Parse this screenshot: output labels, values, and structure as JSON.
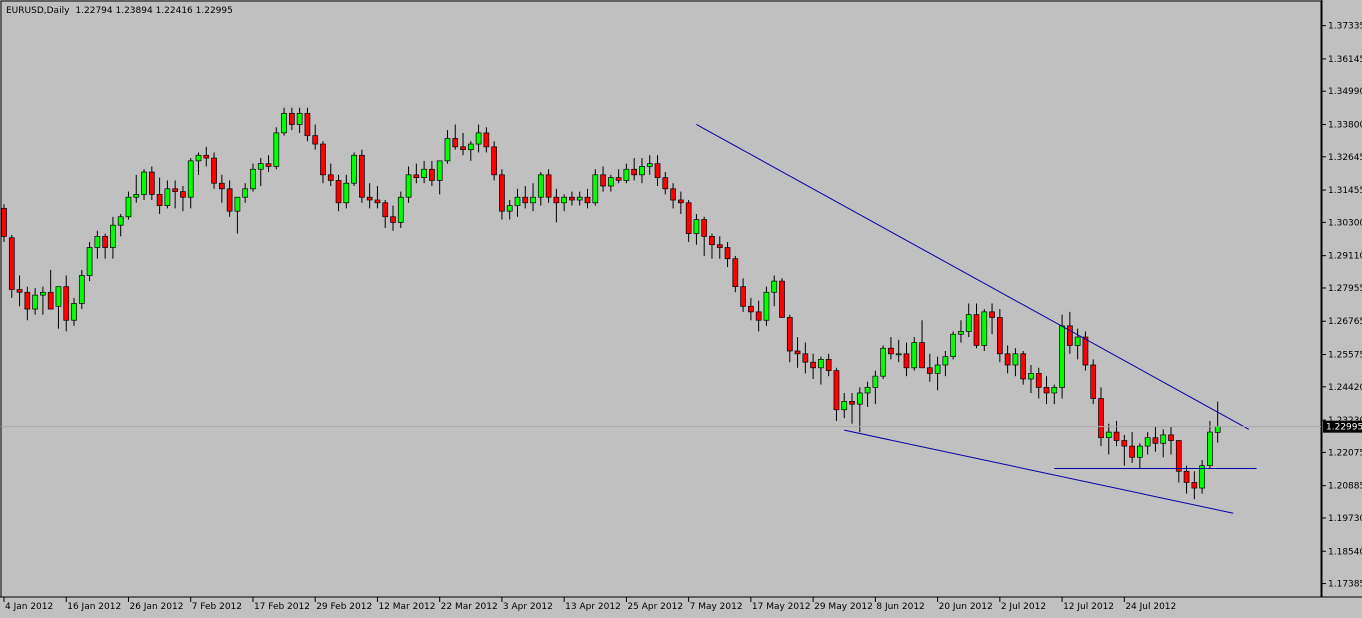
{
  "header": {
    "symbol": "EURUSD,Daily",
    "ohlc": "1.22794 1.23894 1.22416 1.22995"
  },
  "colors": {
    "background": "#c0c0c0",
    "bull_candle": "#00ff00",
    "bear_candle": "#ff0000",
    "wick": "#000000",
    "trendline": "#0000a0",
    "price_marker_bg": "#000000",
    "price_marker_text": "#ffffff"
  },
  "chart_data": {
    "type": "candlestick",
    "symbol": "EURUSD",
    "timeframe": "Daily",
    "ylim": [
      1.1694,
      1.3818
    ],
    "grid": false,
    "y_ticks": [
      "1.37335",
      "1.36145",
      "1.34990",
      "1.33800",
      "1.32645",
      "1.31455",
      "1.30300",
      "1.29110",
      "1.27955",
      "1.26765",
      "1.25575",
      "1.24420",
      "1.23230",
      "1.22075",
      "1.20885",
      "1.19730",
      "1.18540",
      "1.17385"
    ],
    "x_labels": [
      {
        "i": 0,
        "label": "4 Jan 2012"
      },
      {
        "i": 8,
        "label": "16 Jan 2012"
      },
      {
        "i": 16,
        "label": "26 Jan 2012"
      },
      {
        "i": 24,
        "label": "7 Feb 2012"
      },
      {
        "i": 32,
        "label": "17 Feb 2012"
      },
      {
        "i": 40,
        "label": "29 Feb 2012"
      },
      {
        "i": 48,
        "label": "12 Mar 2012"
      },
      {
        "i": 56,
        "label": "22 Mar 2012"
      },
      {
        "i": 64,
        "label": "3 Apr 2012"
      },
      {
        "i": 72,
        "label": "13 Apr 2012"
      },
      {
        "i": 80,
        "label": "25 Apr 2012"
      },
      {
        "i": 88,
        "label": "7 May 2012"
      },
      {
        "i": 96,
        "label": "17 May 2012"
      },
      {
        "i": 104,
        "label": "29 May 2012"
      },
      {
        "i": 112,
        "label": "8 Jun 2012"
      },
      {
        "i": 120,
        "label": "20 Jun 2012"
      },
      {
        "i": 128,
        "label": "2 Jul 2012"
      },
      {
        "i": 136,
        "label": "12 Jul 2012"
      },
      {
        "i": 144,
        "label": "24 Jul 2012"
      }
    ],
    "last_price": "1.22995",
    "candles": [
      [
        1.308,
        1.3095,
        1.296,
        1.298
      ],
      [
        1.2975,
        1.2985,
        1.276,
        1.279
      ],
      [
        1.279,
        1.284,
        1.273,
        1.278
      ],
      [
        1.278,
        1.28,
        1.268,
        1.272
      ],
      [
        1.272,
        1.2795,
        1.27,
        1.277
      ],
      [
        1.277,
        1.28,
        1.27,
        1.278
      ],
      [
        1.278,
        1.286,
        1.274,
        1.272
      ],
      [
        1.273,
        1.279,
        1.265,
        1.28
      ],
      [
        1.28,
        1.284,
        1.264,
        1.268
      ],
      [
        1.268,
        1.276,
        1.266,
        1.274
      ],
      [
        1.274,
        1.286,
        1.272,
        1.284
      ],
      [
        1.284,
        1.296,
        1.282,
        1.294
      ],
      [
        1.294,
        1.3,
        1.29,
        1.298
      ],
      [
        1.298,
        1.299,
        1.29,
        1.294
      ],
      [
        1.294,
        1.305,
        1.29,
        1.302
      ],
      [
        1.302,
        1.306,
        1.298,
        1.305
      ],
      [
        1.305,
        1.314,
        1.304,
        1.312
      ],
      [
        1.312,
        1.32,
        1.31,
        1.313
      ],
      [
        1.313,
        1.322,
        1.311,
        1.321
      ],
      [
        1.321,
        1.323,
        1.311,
        1.313
      ],
      [
        1.313,
        1.319,
        1.306,
        1.309
      ],
      [
        1.309,
        1.318,
        1.308,
        1.315
      ],
      [
        1.315,
        1.318,
        1.308,
        1.314
      ],
      [
        1.314,
        1.316,
        1.307,
        1.312
      ],
      [
        1.312,
        1.326,
        1.308,
        1.325
      ],
      [
        1.325,
        1.328,
        1.32,
        1.327
      ],
      [
        1.327,
        1.33,
        1.323,
        1.326
      ],
      [
        1.326,
        1.328,
        1.315,
        1.317
      ],
      [
        1.317,
        1.32,
        1.31,
        1.315
      ],
      [
        1.315,
        1.318,
        1.305,
        1.307
      ],
      [
        1.307,
        1.31,
        1.299,
        1.312
      ],
      [
        1.312,
        1.317,
        1.31,
        1.315
      ],
      [
        1.315,
        1.324,
        1.314,
        1.322
      ],
      [
        1.322,
        1.326,
        1.316,
        1.324
      ],
      [
        1.324,
        1.327,
        1.321,
        1.323
      ],
      [
        1.323,
        1.337,
        1.322,
        1.335
      ],
      [
        1.335,
        1.344,
        1.334,
        1.342
      ],
      [
        1.342,
        1.344,
        1.336,
        1.338
      ],
      [
        1.338,
        1.344,
        1.335,
        1.342
      ],
      [
        1.342,
        1.344,
        1.332,
        1.334
      ],
      [
        1.334,
        1.338,
        1.329,
        1.331
      ],
      [
        1.331,
        1.332,
        1.317,
        1.32
      ],
      [
        1.32,
        1.324,
        1.316,
        1.318
      ],
      [
        1.318,
        1.32,
        1.307,
        1.31
      ],
      [
        1.31,
        1.32,
        1.308,
        1.317
      ],
      [
        1.317,
        1.328,
        1.316,
        1.327
      ],
      [
        1.327,
        1.329,
        1.31,
        1.312
      ],
      [
        1.312,
        1.317,
        1.308,
        1.311
      ],
      [
        1.311,
        1.316,
        1.308,
        1.31
      ],
      [
        1.31,
        1.311,
        1.301,
        1.305
      ],
      [
        1.305,
        1.309,
        1.3,
        1.303
      ],
      [
        1.303,
        1.314,
        1.301,
        1.312
      ],
      [
        1.312,
        1.323,
        1.31,
        1.32
      ],
      [
        1.32,
        1.324,
        1.317,
        1.319
      ],
      [
        1.319,
        1.325,
        1.317,
        1.322
      ],
      [
        1.322,
        1.325,
        1.316,
        1.318
      ],
      [
        1.318,
        1.321,
        1.313,
        1.325
      ],
      [
        1.325,
        1.336,
        1.324,
        1.333
      ],
      [
        1.333,
        1.338,
        1.329,
        1.33
      ],
      [
        1.33,
        1.335,
        1.327,
        1.329
      ],
      [
        1.329,
        1.332,
        1.325,
        1.331
      ],
      [
        1.331,
        1.338,
        1.328,
        1.335
      ],
      [
        1.335,
        1.337,
        1.328,
        1.33
      ],
      [
        1.33,
        1.332,
        1.318,
        1.32
      ],
      [
        1.32,
        1.322,
        1.304,
        1.307
      ],
      [
        1.307,
        1.311,
        1.304,
        1.309
      ],
      [
        1.309,
        1.315,
        1.305,
        1.312
      ],
      [
        1.312,
        1.316,
        1.308,
        1.31
      ],
      [
        1.31,
        1.317,
        1.307,
        1.312
      ],
      [
        1.312,
        1.321,
        1.309,
        1.32
      ],
      [
        1.32,
        1.322,
        1.31,
        1.312
      ],
      [
        1.312,
        1.315,
        1.303,
        1.31
      ],
      [
        1.31,
        1.313,
        1.307,
        1.312
      ],
      [
        1.312,
        1.314,
        1.309,
        1.311
      ],
      [
        1.311,
        1.314,
        1.309,
        1.312
      ],
      [
        1.312,
        1.315,
        1.308,
        1.31
      ],
      [
        1.31,
        1.322,
        1.309,
        1.32
      ],
      [
        1.32,
        1.323,
        1.314,
        1.316
      ],
      [
        1.316,
        1.32,
        1.314,
        1.319
      ],
      [
        1.319,
        1.322,
        1.317,
        1.318
      ],
      [
        1.318,
        1.324,
        1.317,
        1.322
      ],
      [
        1.322,
        1.326,
        1.318,
        1.32
      ],
      [
        1.32,
        1.326,
        1.317,
        1.323
      ],
      [
        1.323,
        1.327,
        1.32,
        1.324
      ],
      [
        1.324,
        1.327,
        1.316,
        1.319
      ],
      [
        1.319,
        1.321,
        1.313,
        1.315
      ],
      [
        1.315,
        1.317,
        1.308,
        1.311
      ],
      [
        1.311,
        1.314,
        1.306,
        1.31
      ],
      [
        1.31,
        1.311,
        1.296,
        1.299
      ],
      [
        1.299,
        1.306,
        1.295,
        1.304
      ],
      [
        1.304,
        1.305,
        1.291,
        1.298
      ],
      [
        1.298,
        1.299,
        1.29,
        1.295
      ],
      [
        1.295,
        1.298,
        1.29,
        1.294
      ],
      [
        1.294,
        1.296,
        1.287,
        1.29
      ],
      [
        1.29,
        1.291,
        1.278,
        1.28
      ],
      [
        1.28,
        1.283,
        1.271,
        1.273
      ],
      [
        1.273,
        1.276,
        1.268,
        1.271
      ],
      [
        1.271,
        1.275,
        1.264,
        1.268
      ],
      [
        1.268,
        1.28,
        1.266,
        1.278
      ],
      [
        1.278,
        1.284,
        1.273,
        1.282
      ],
      [
        1.282,
        1.283,
        1.27,
        1.269
      ],
      [
        1.269,
        1.27,
        1.253,
        1.257
      ],
      [
        1.257,
        1.262,
        1.251,
        1.256
      ],
      [
        1.256,
        1.26,
        1.249,
        1.253
      ],
      [
        1.253,
        1.256,
        1.247,
        1.251
      ],
      [
        1.251,
        1.255,
        1.245,
        1.254
      ],
      [
        1.254,
        1.256,
        1.248,
        1.25
      ],
      [
        1.25,
        1.251,
        1.232,
        1.236
      ],
      [
        1.236,
        1.242,
        1.233,
        1.239
      ],
      [
        1.239,
        1.242,
        1.231,
        1.238
      ],
      [
        1.238,
        1.244,
        1.228,
        1.242
      ],
      [
        1.242,
        1.246,
        1.237,
        1.244
      ],
      [
        1.244,
        1.25,
        1.238,
        1.248
      ],
      [
        1.248,
        1.259,
        1.247,
        1.258
      ],
      [
        1.258,
        1.262,
        1.254,
        1.256
      ],
      [
        1.256,
        1.261,
        1.253,
        1.256
      ],
      [
        1.256,
        1.26,
        1.248,
        1.251
      ],
      [
        1.251,
        1.262,
        1.25,
        1.26
      ],
      [
        1.26,
        1.268,
        1.258,
        1.251
      ],
      [
        1.251,
        1.256,
        1.246,
        1.249
      ],
      [
        1.249,
        1.255,
        1.243,
        1.252
      ],
      [
        1.252,
        1.257,
        1.248,
        1.255
      ],
      [
        1.255,
        1.264,
        1.254,
        1.263
      ],
      [
        1.263,
        1.268,
        1.26,
        1.264
      ],
      [
        1.264,
        1.274,
        1.262,
        1.27
      ],
      [
        1.27,
        1.274,
        1.258,
        1.259
      ],
      [
        1.259,
        1.272,
        1.257,
        1.271
      ],
      [
        1.271,
        1.274,
        1.263,
        1.269
      ],
      [
        1.269,
        1.272,
        1.253,
        1.256
      ],
      [
        1.256,
        1.259,
        1.249,
        1.252
      ],
      [
        1.252,
        1.258,
        1.248,
        1.256
      ],
      [
        1.256,
        1.257,
        1.245,
        1.247
      ],
      [
        1.247,
        1.252,
        1.242,
        1.249
      ],
      [
        1.249,
        1.251,
        1.24,
        1.244
      ],
      [
        1.244,
        1.248,
        1.238,
        1.242
      ],
      [
        1.242,
        1.245,
        1.238,
        1.244
      ],
      [
        1.244,
        1.27,
        1.24,
        1.266
      ],
      [
        1.266,
        1.271,
        1.256,
        1.259
      ],
      [
        1.259,
        1.265,
        1.254,
        1.262
      ],
      [
        1.262,
        1.264,
        1.25,
        1.252
      ],
      [
        1.252,
        1.254,
        1.238,
        1.24
      ],
      [
        1.24,
        1.244,
        1.223,
        1.226
      ],
      [
        1.226,
        1.231,
        1.22,
        1.228
      ],
      [
        1.228,
        1.232,
        1.223,
        1.225
      ],
      [
        1.225,
        1.227,
        1.216,
        1.223
      ],
      [
        1.223,
        1.228,
        1.217,
        1.219
      ],
      [
        1.219,
        1.224,
        1.215,
        1.223
      ],
      [
        1.223,
        1.228,
        1.22,
        1.226
      ],
      [
        1.226,
        1.23,
        1.221,
        1.224
      ],
      [
        1.224,
        1.229,
        1.219,
        1.227
      ],
      [
        1.227,
        1.23,
        1.22,
        1.225
      ],
      [
        1.225,
        1.225,
        1.21,
        1.214
      ],
      [
        1.214,
        1.216,
        1.206,
        1.21
      ],
      [
        1.21,
        1.214,
        1.204,
        1.208
      ],
      [
        1.208,
        1.218,
        1.206,
        1.216
      ],
      [
        1.216,
        1.232,
        1.215,
        1.228
      ],
      [
        1.2279,
        1.2389,
        1.2242,
        1.23
      ]
    ],
    "trendlines": [
      {
        "i1": 89,
        "p1": 1.338,
        "i2": 160,
        "p2": 1.229
      },
      {
        "i1": 108,
        "p1": 1.2287,
        "i2": 158,
        "p2": 1.199
      },
      {
        "i1": 135,
        "p1": 1.215,
        "i2": 161,
        "p2": 1.215
      }
    ]
  }
}
